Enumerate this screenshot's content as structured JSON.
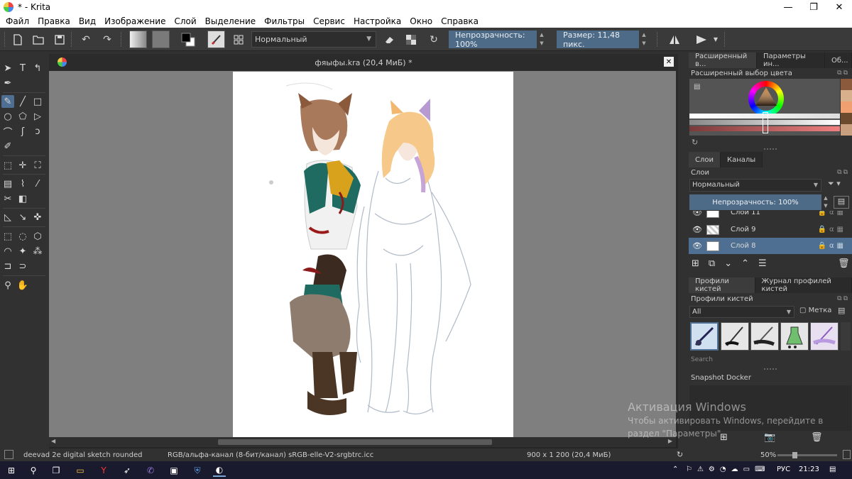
{
  "window": {
    "title": "* - Krita",
    "min_glyph": "—",
    "max_glyph": "❐",
    "close_glyph": "✕"
  },
  "menu": [
    "Файл",
    "Правка",
    "Вид",
    "Изображение",
    "Слой",
    "Выделение",
    "Фильтры",
    "Сервис",
    "Настройка",
    "Окно",
    "Справка"
  ],
  "toolbar": {
    "blend_mode": "Нормальный",
    "opacity_label": "Непрозрачность: 100%",
    "size_label": "Размер: 11,48 пикс.",
    "overflow_label": "Об..."
  },
  "document": {
    "tab_title": "фяыфы.kra (20,4 МиБ) *"
  },
  "dockers": {
    "top_tabs": [
      "Расширенный в...",
      "Параметры ин...",
      "Об..."
    ],
    "color_title": "Расширенный выбор цвета",
    "layer_tabs": [
      "Слои",
      "Каналы"
    ],
    "layers_title": "Слои",
    "layers_blend": "Нормальный",
    "layers_opacity": "Непрозрачность:  100%",
    "layers": [
      {
        "name": "Слой 11",
        "selected": false
      },
      {
        "name": "Слой 9",
        "selected": false
      },
      {
        "name": "Слой 8",
        "selected": true
      }
    ],
    "brush_tabs": [
      "Профили кистей",
      "Журнал профилей кистей"
    ],
    "brush_title": "Профили кистей",
    "brush_filter": "All",
    "brush_tag": "Метка",
    "brush_search": "Search",
    "snapshot_title": "Snapshot Docker",
    "colors": {
      "swatches": [
        "#8b5a3c",
        "#d9b08c",
        "#f0a070",
        "#6b4a2e",
        "#c8a080"
      ]
    }
  },
  "status": {
    "brush": "deevad 2e digital sketch rounded",
    "colorspace": "RGB/альфа-канал (8-бит/канал)  sRGB-elle-V2-srgbtrc.icc",
    "dimensions": "900 x 1 200 (20,4 МиБ)",
    "zoom": "50%"
  },
  "watermark": {
    "line1": "Активация Windows",
    "line2": "Чтобы активировать Windows, перейдите в",
    "line3": "раздел \"Параметры\"."
  },
  "taskbar": {
    "lang": "РУС",
    "time": "21:23"
  }
}
